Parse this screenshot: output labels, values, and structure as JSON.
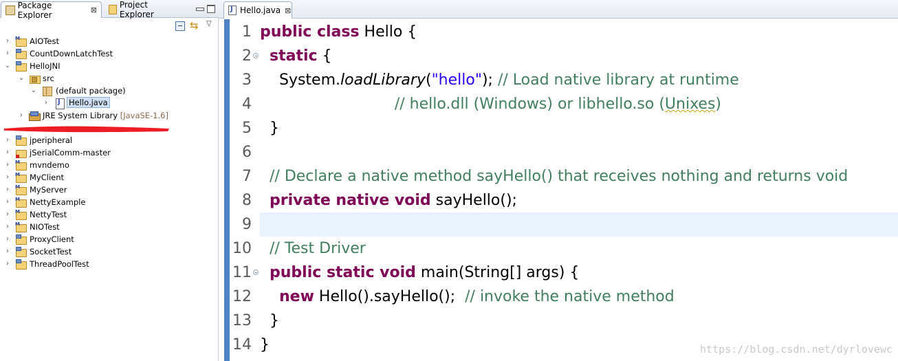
{
  "left_panel": {
    "tabs": [
      {
        "label": "Package Explorer",
        "icon": "package-explorer-icon",
        "active": true
      },
      {
        "label": "Project Explorer",
        "icon": "project-explorer-icon",
        "active": false
      }
    ],
    "close_glyph": "⊠",
    "view_menu_glyph": "▽",
    "tree": [
      {
        "label": "AIOTest",
        "icon": "maven-project-icon",
        "expanded": false
      },
      {
        "label": "CountDownLatchTest",
        "icon": "project-icon",
        "expanded": false
      },
      {
        "label": "HelloJNI",
        "icon": "project-icon",
        "expanded": true
      },
      {
        "label": "src",
        "icon": "source-folder-icon",
        "expanded": true
      },
      {
        "label": "(default package)",
        "icon": "package-icon",
        "expanded": true
      },
      {
        "label": "Hello.java",
        "icon": "java-file-icon",
        "selected": true
      },
      {
        "label": "JRE System Library",
        "suffix": "[JavaSE-1.6]",
        "icon": "jre-library-icon"
      },
      {
        "label": "jperipheral",
        "icon": "project-icon"
      },
      {
        "label": "jSerialComm-master",
        "icon": "project-error-icon"
      },
      {
        "label": "mvndemo",
        "icon": "maven-project-icon"
      },
      {
        "label": "MyClient",
        "icon": "maven-project-icon"
      },
      {
        "label": "MyServer",
        "icon": "maven-project-icon"
      },
      {
        "label": "NettyExample",
        "icon": "maven-project-icon"
      },
      {
        "label": "NettyTest",
        "icon": "maven-project-icon"
      },
      {
        "label": "NIOTest",
        "icon": "maven-project-icon"
      },
      {
        "label": "ProxyClient",
        "icon": "project-icon"
      },
      {
        "label": "SocketTest",
        "icon": "project-icon"
      },
      {
        "label": "ThreadPoolTest",
        "icon": "project-icon"
      }
    ],
    "redaction_color": "#ee1c24"
  },
  "editor": {
    "tab_label": "Hello.java",
    "close_glyph": "⊠",
    "line_numbers": [
      "1",
      "2",
      "3",
      "4",
      "5",
      "6",
      "7",
      "8",
      "9",
      "10",
      "11",
      "12",
      "13",
      "14"
    ],
    "lines": {
      "l1": {
        "kw": "public class",
        "rest": " Hello {"
      },
      "l2": {
        "indent": "  ",
        "kw": "static",
        "rest": " {"
      },
      "l3": {
        "indent": "    ",
        "plain1": "System.",
        "method": "loadLibrary",
        "plain2": "(",
        "str": "\"hello\"",
        "plain3": "); ",
        "comment": "// Load native library at runtime"
      },
      "l4": {
        "indent": "                            ",
        "comment_a": "// hello.dll (Windows) or libhello.so (",
        "comment_b": "Unixes",
        "comment_c": ")"
      },
      "l5": {
        "indent": "  ",
        "rest": "}"
      },
      "l6": {
        "rest": ""
      },
      "l7": {
        "indent": "  ",
        "comment": "// Declare a native method sayHello() that receives nothing and returns void"
      },
      "l8": {
        "indent": "  ",
        "kw": "private native void",
        "rest": " sayHello();"
      },
      "l9": {
        "rest": ""
      },
      "l10": {
        "indent": "  ",
        "comment": "// Test Driver"
      },
      "l11": {
        "indent": "  ",
        "kw": "public static void",
        "rest": " main(String[] args) {"
      },
      "l12": {
        "indent": "    ",
        "kw": "new",
        "rest": " Hello().sayHello();  ",
        "comment": "// invoke the native method"
      },
      "l13": {
        "indent": "  ",
        "rest": "}"
      },
      "l14": {
        "rest": "}"
      }
    },
    "watermark": "https://blog.csdn.net/dyrlovewc",
    "colors": {
      "keyword": "#7f0055",
      "comment": "#3f7f5f",
      "string": "#2a00ff",
      "current_line": "#e8f2fe"
    }
  }
}
